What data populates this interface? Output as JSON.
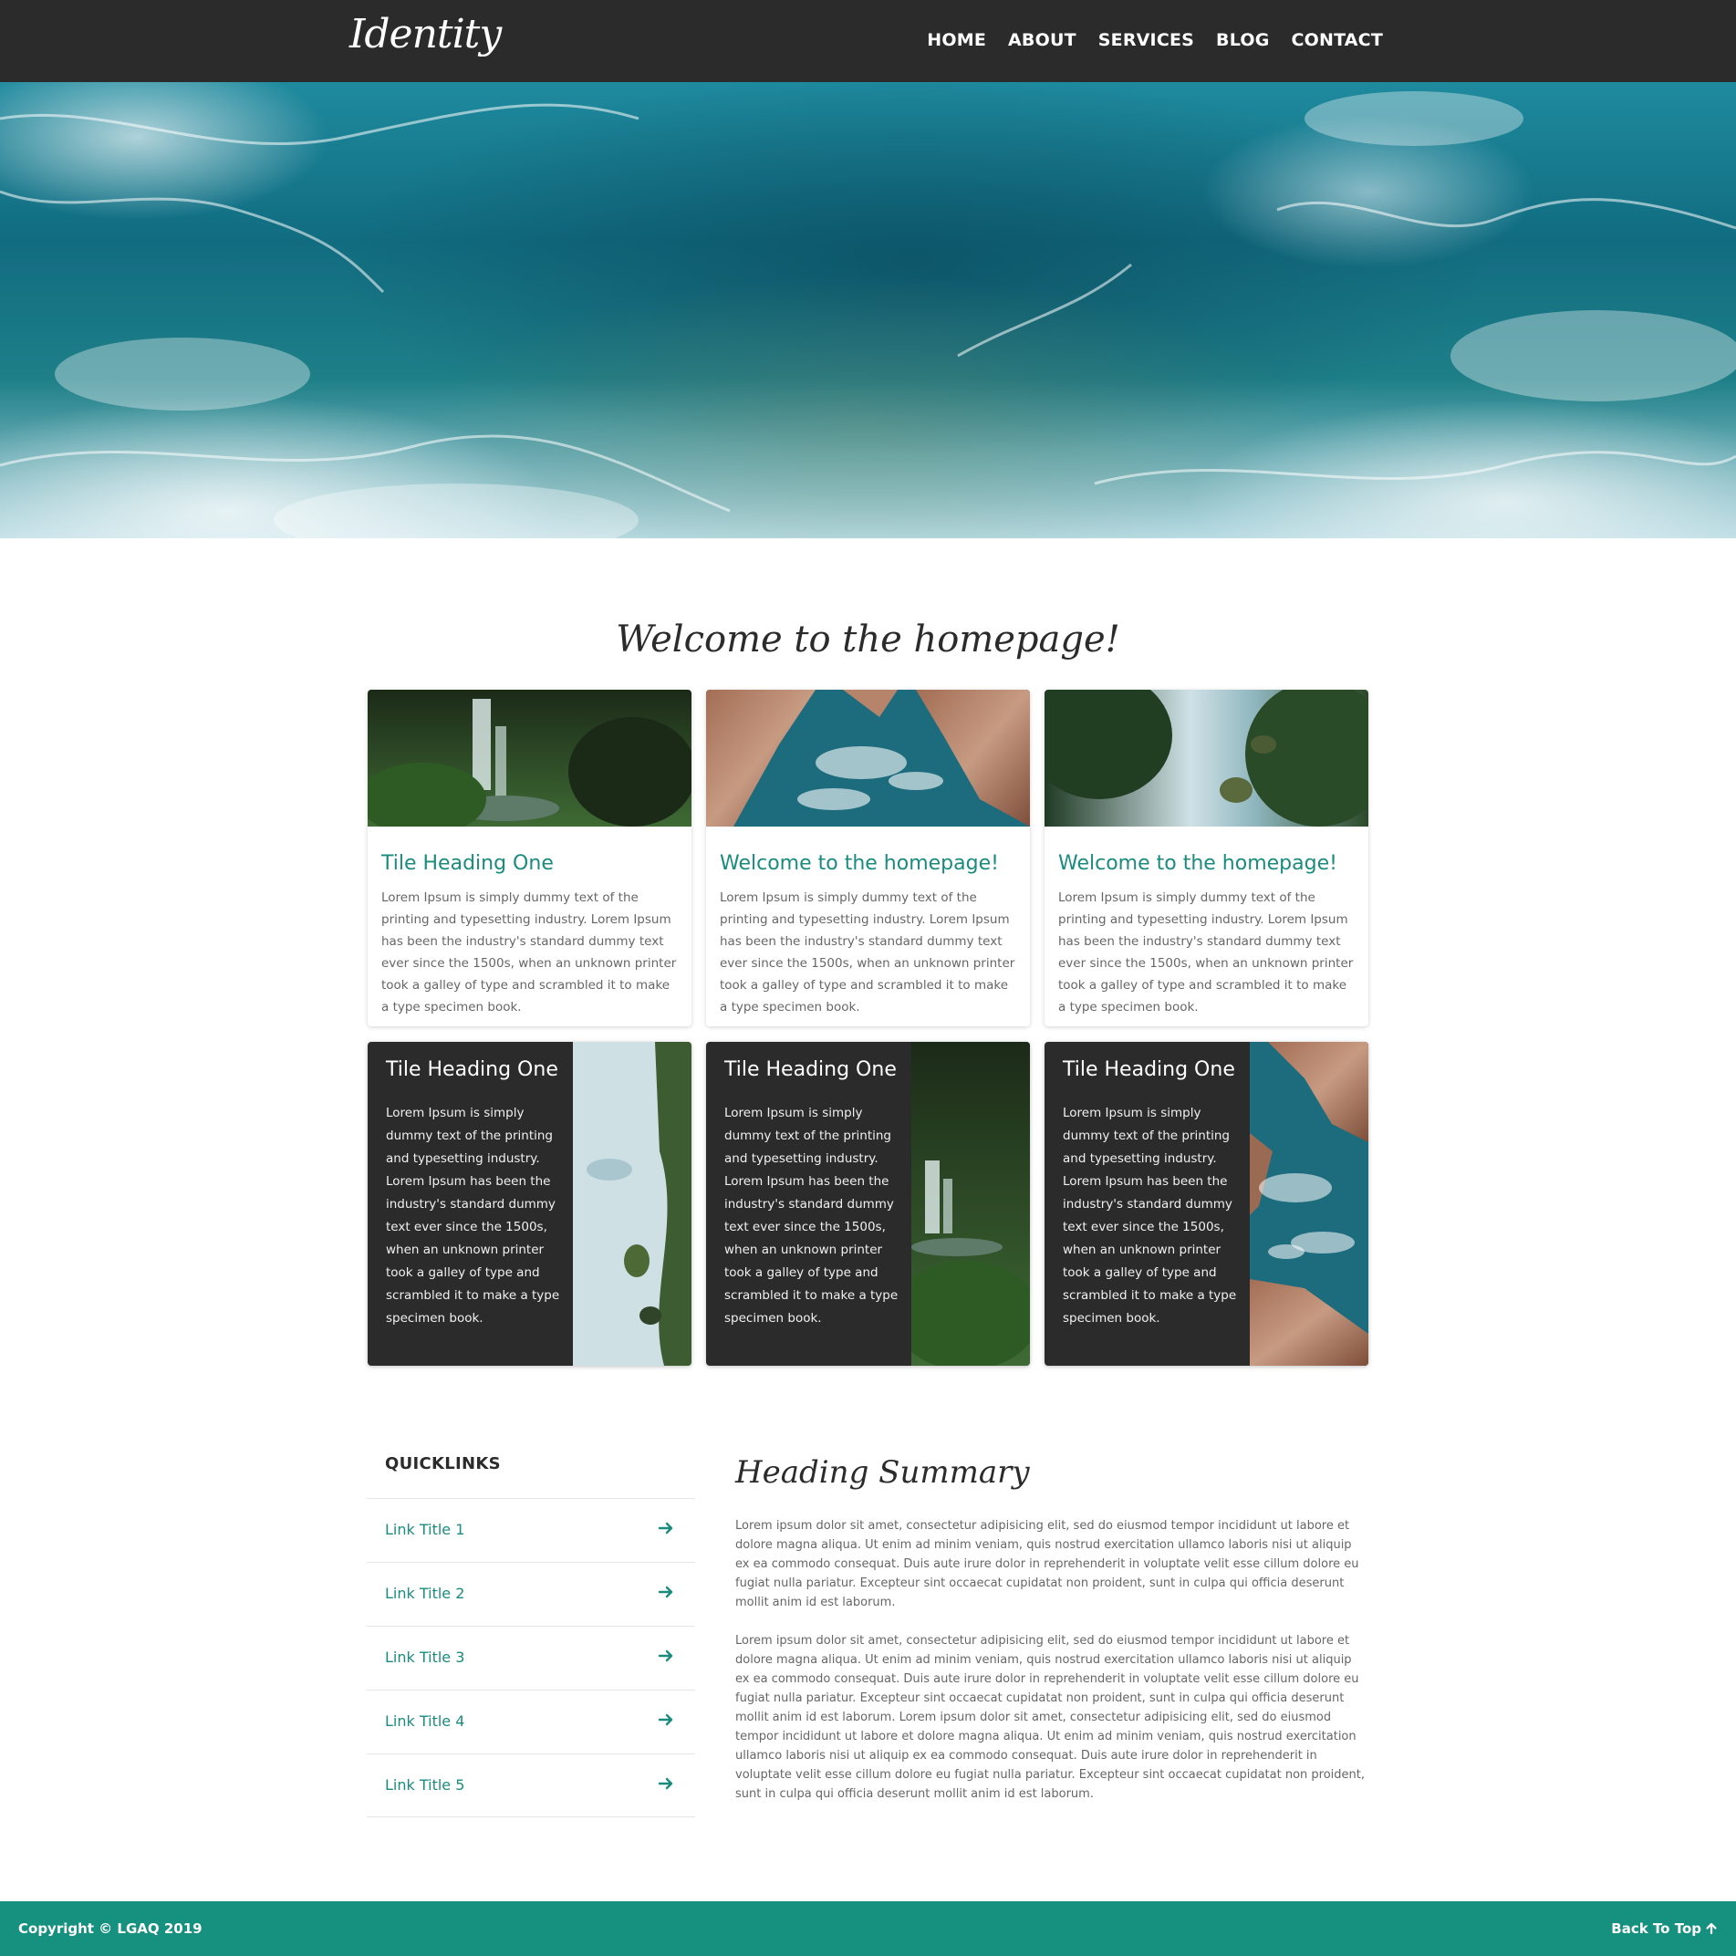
{
  "header": {
    "logo": "Identity",
    "nav": [
      "HOME",
      "ABOUT",
      "SERVICES",
      "BLOG",
      "CONTACT"
    ]
  },
  "welcome": {
    "title": "Welcome to the homepage!"
  },
  "cards": [
    {
      "heading": "Tile Heading One",
      "text": "Lorem Ipsum is simply dummy text of the printing and typesetting industry. Lorem Ipsum has been the industry's standard dummy text ever since the 1500s, when an unknown printer took a galley of type and scrambled it to make a type specimen book.",
      "image": "waterfall-forest"
    },
    {
      "heading": "Welcome to the homepage!",
      "text": "Lorem Ipsum is simply dummy text of the printing and typesetting industry. Lorem Ipsum has been the industry's standard dummy text ever since the 1500s, when an unknown printer took a galley of type and scrambled it to make a type specimen book.",
      "image": "rocky-coast"
    },
    {
      "heading": "Welcome to the homepage!",
      "text": "Lorem Ipsum is simply dummy text of the printing and typesetting industry. Lorem Ipsum has been the industry's standard dummy text ever since the 1500s, when an unknown printer took a galley of type and scrambled it to make a type specimen book.",
      "image": "river-forest"
    }
  ],
  "dark_cards": [
    {
      "heading": "Tile Heading One",
      "text": "Lorem Ipsum is simply dummy text of the printing and typesetting industry. Lorem Ipsum has been the industry's standard dummy text ever since the 1500s, when an unknown printer took a galley of type and scrambled it to make a type specimen book.",
      "image": "river-forest"
    },
    {
      "heading": "Tile Heading One",
      "text": "Lorem Ipsum is simply dummy text of the printing and typesetting industry. Lorem Ipsum has been the industry's standard dummy text ever since the 1500s, when an unknown printer took a galley of type and scrambled it to make a type specimen book.",
      "image": "waterfall-forest"
    },
    {
      "heading": "Tile Heading One",
      "text": "Lorem Ipsum is simply dummy text of the printing and typesetting industry. Lorem Ipsum has been the industry's standard dummy text ever since the 1500s, when an unknown printer took a galley of type and scrambled it to make a type specimen book.",
      "image": "rocky-coast"
    }
  ],
  "quicklinks": {
    "title": "QUICKLINKS",
    "items": [
      "Link Title 1",
      "Link Title 2",
      "Link Title 3",
      "Link Title 4",
      "Link Title 5"
    ],
    "arrow_icon": "arrow-right-icon"
  },
  "summary": {
    "title": "Heading Summary",
    "p1": "Lorem ipsum dolor sit amet, consectetur adipisicing elit, sed do eiusmod tempor incididunt ut labore et dolore magna aliqua. Ut enim ad minim veniam, quis nostrud exercitation ullamco laboris nisi ut aliquip ex ea commodo consequat. Duis aute irure dolor in reprehenderit in voluptate velit esse cillum dolore eu fugiat nulla pariatur. Excepteur sint occaecat cupidatat non proident, sunt in culpa qui officia deserunt mollit anim id est laborum.",
    "p2": "Lorem ipsum dolor sit amet, consectetur adipisicing elit, sed do eiusmod tempor incididunt ut labore et dolore magna aliqua. Ut enim ad minim veniam, quis nostrud exercitation ullamco laboris nisi ut aliquip ex ea commodo consequat. Duis aute irure dolor in reprehenderit in voluptate velit esse cillum dolore eu fugiat nulla pariatur. Excepteur sint occaecat cupidatat non proident, sunt in culpa qui officia deserunt mollit anim id est laborum. Lorem ipsum dolor sit amet, consectetur adipisicing elit, sed do eiusmod tempor incididunt ut labore et dolore magna aliqua. Ut enim ad minim veniam, quis nostrud exercitation ullamco laboris nisi ut aliquip ex ea commodo consequat. Duis aute irure dolor in reprehenderit in voluptate velit esse cillum dolore eu fugiat nulla pariatur. Excepteur sint occaecat cupidatat non proident, sunt in culpa qui officia deserunt mollit anim id est laborum."
  },
  "footer": {
    "copyright": "Copyright © LGAQ 2019",
    "back_to_top": "Back To Top",
    "back_icon": "arrow-up-icon"
  },
  "colors": {
    "nav_bg": "#2b2b2b",
    "accent": "#1a8c7e",
    "footer_bg": "#16917f",
    "dark_card_bg": "#2b2b2b"
  }
}
